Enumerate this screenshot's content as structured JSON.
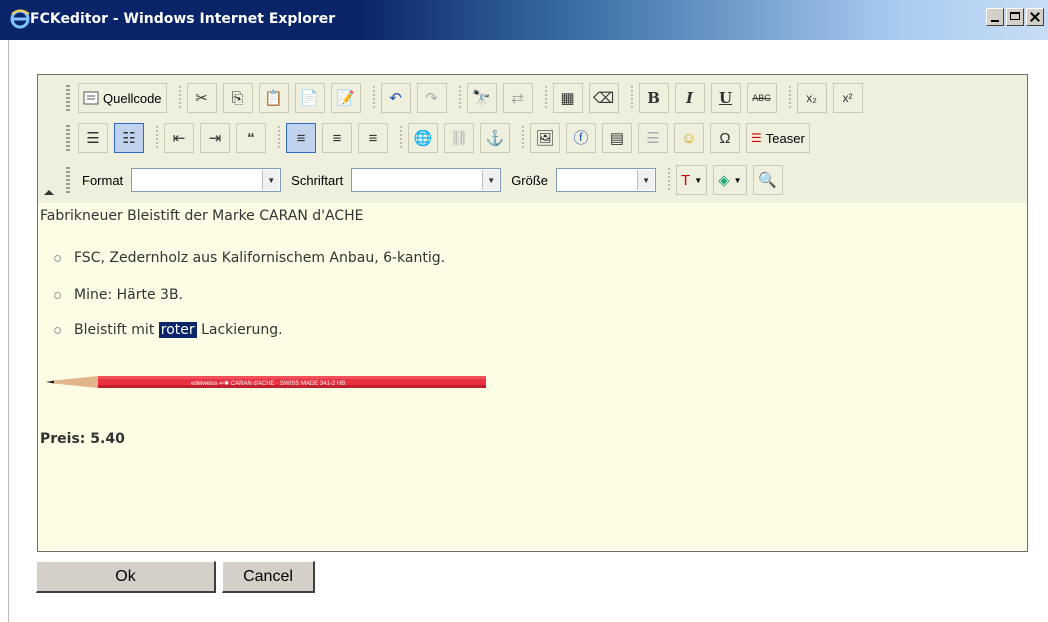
{
  "window": {
    "title": "FCKeditor - Windows Internet Explorer",
    "buttons": [
      "minimize",
      "maximize",
      "close"
    ]
  },
  "toolbar": {
    "row1": [
      {
        "name": "source",
        "label": "Quellcode",
        "icon": "source-icon"
      },
      {
        "name": "cut",
        "icon": "scissors-icon"
      },
      {
        "name": "copy",
        "icon": "copy-icon"
      },
      {
        "name": "paste",
        "icon": "paste-icon"
      },
      {
        "name": "paste-text",
        "icon": "paste-text-icon"
      },
      {
        "name": "paste-word",
        "icon": "paste-word-icon"
      },
      {
        "name": "undo",
        "icon": "undo-icon"
      },
      {
        "name": "redo",
        "icon": "redo-icon"
      },
      {
        "name": "find",
        "icon": "binoculars-icon"
      },
      {
        "name": "replace",
        "icon": "replace-icon"
      },
      {
        "name": "select-all",
        "icon": "select-all-icon"
      },
      {
        "name": "remove-format",
        "icon": "eraser-icon"
      },
      {
        "name": "bold",
        "glyph": "B"
      },
      {
        "name": "italic",
        "glyph": "I"
      },
      {
        "name": "underline",
        "glyph": "U"
      },
      {
        "name": "strike",
        "glyph": "ABC"
      },
      {
        "name": "subscript",
        "glyph": "x₂"
      },
      {
        "name": "superscript",
        "glyph": "x²"
      }
    ],
    "row2": [
      {
        "name": "ordered-list",
        "icon": "ordered-list-icon"
      },
      {
        "name": "unordered-list",
        "icon": "unordered-list-icon",
        "active": true
      },
      {
        "name": "outdent",
        "icon": "outdent-icon"
      },
      {
        "name": "indent",
        "icon": "indent-icon"
      },
      {
        "name": "blockquote",
        "glyph": "“"
      },
      {
        "name": "align-left",
        "icon": "align-left-icon",
        "active": true
      },
      {
        "name": "align-center",
        "icon": "align-center-icon"
      },
      {
        "name": "align-right",
        "icon": "align-right-icon"
      },
      {
        "name": "link",
        "icon": "link-icon"
      },
      {
        "name": "unlink",
        "icon": "unlink-icon"
      },
      {
        "name": "anchor",
        "icon": "anchor-icon"
      },
      {
        "name": "image",
        "icon": "image-icon"
      },
      {
        "name": "flash",
        "icon": "flash-icon"
      },
      {
        "name": "table",
        "icon": "table-icon"
      },
      {
        "name": "horizontal-rule",
        "icon": "rule-icon"
      },
      {
        "name": "smiley",
        "icon": "smiley-icon"
      },
      {
        "name": "special-char",
        "icon": "special-char-icon"
      },
      {
        "name": "teaser",
        "label": "Teaser",
        "icon": "teaser-icon"
      }
    ],
    "row3": {
      "format_label": "Format",
      "format_value": "",
      "font_label": "Schriftart",
      "font_value": "",
      "size_label": "Größe",
      "size_value": ""
    }
  },
  "content": {
    "paragraph": "Fabrikneuer Bleistift der Marke CARAN d'ACHE",
    "list": [
      {
        "text": "FSC, Zedernholz aus Kalifornischem Anbau, 6-kantig."
      },
      {
        "text": "Mine: Härte 3B."
      },
      {
        "before": "Bleistift mit ",
        "selected": "roter",
        "after": " Lackierung."
      }
    ],
    "pencil_imprint": "edelweiss  ⇐✱  CARAN d'ACHE · SWISS MADE  341-2  HB",
    "price": "Preis: 5.40"
  },
  "dialog": {
    "ok_label": "Ok",
    "cancel_label": "Cancel"
  },
  "colors": {
    "titlebar": "#0a246a",
    "toolbar_bg": "#efefde",
    "content_bg": "#fdfde6",
    "selection": "#0a246a",
    "pencil": "#e8303f"
  }
}
